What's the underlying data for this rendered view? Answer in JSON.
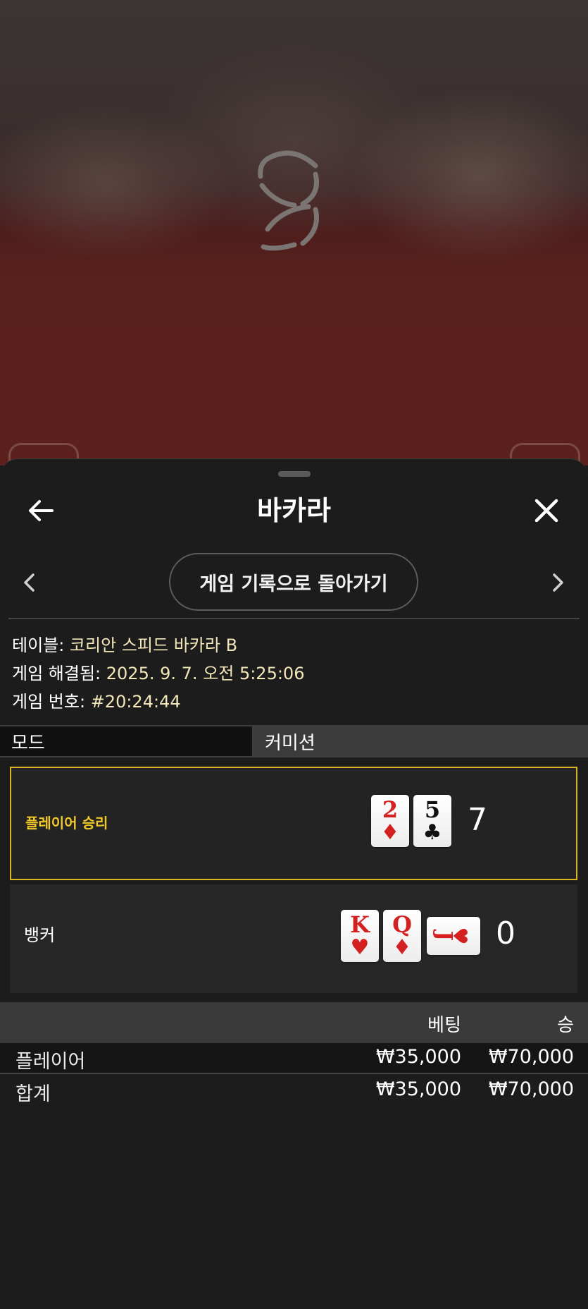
{
  "header": {
    "title": "바카라"
  },
  "nav": {
    "back_to_history_label": "게임 기록으로 돌아가기"
  },
  "info": {
    "table_label": "테이블:",
    "table_value": "코리안 스피드 바카라 B",
    "resolved_label": "게임 해결됨:",
    "resolved_value": "2025. 9. 7. 오전 5:25:06",
    "game_no_label": "게임 번호:",
    "game_no_value": "#20:24:44"
  },
  "tabs": {
    "mode": "모드",
    "commission": "커미션"
  },
  "results": {
    "player": {
      "label": "플레이어 승리",
      "score": "7",
      "cards": [
        {
          "rank": "2",
          "suit": "♦",
          "color": "#d32020"
        },
        {
          "rank": "5",
          "suit": "♣",
          "color": "#111111"
        }
      ]
    },
    "banker": {
      "label": "뱅커",
      "score": "0",
      "cards": [
        {
          "rank": "K",
          "suit": "♥",
          "color": "#d32020"
        },
        {
          "rank": "Q",
          "suit": "♦",
          "color": "#d32020"
        },
        {
          "rank": "J",
          "suit": "♥",
          "color": "#d32020",
          "rotated": true
        }
      ]
    }
  },
  "bets": {
    "columns": {
      "bet": "베팅",
      "win": "승"
    },
    "rows": [
      {
        "label": "플레이어",
        "bet": "₩35,000",
        "win": "₩70,000"
      },
      {
        "label": "합계",
        "bet": "₩35,000",
        "win": "₩70,000"
      }
    ]
  },
  "colors": {
    "winner_border": "#d9b524",
    "winner_label": "#f0c829",
    "info_value": "#f3e6b8"
  },
  "icons": [
    "arrow-left-icon",
    "close-icon",
    "chevron-left-icon",
    "chevron-right-icon",
    "brand-logo"
  ]
}
